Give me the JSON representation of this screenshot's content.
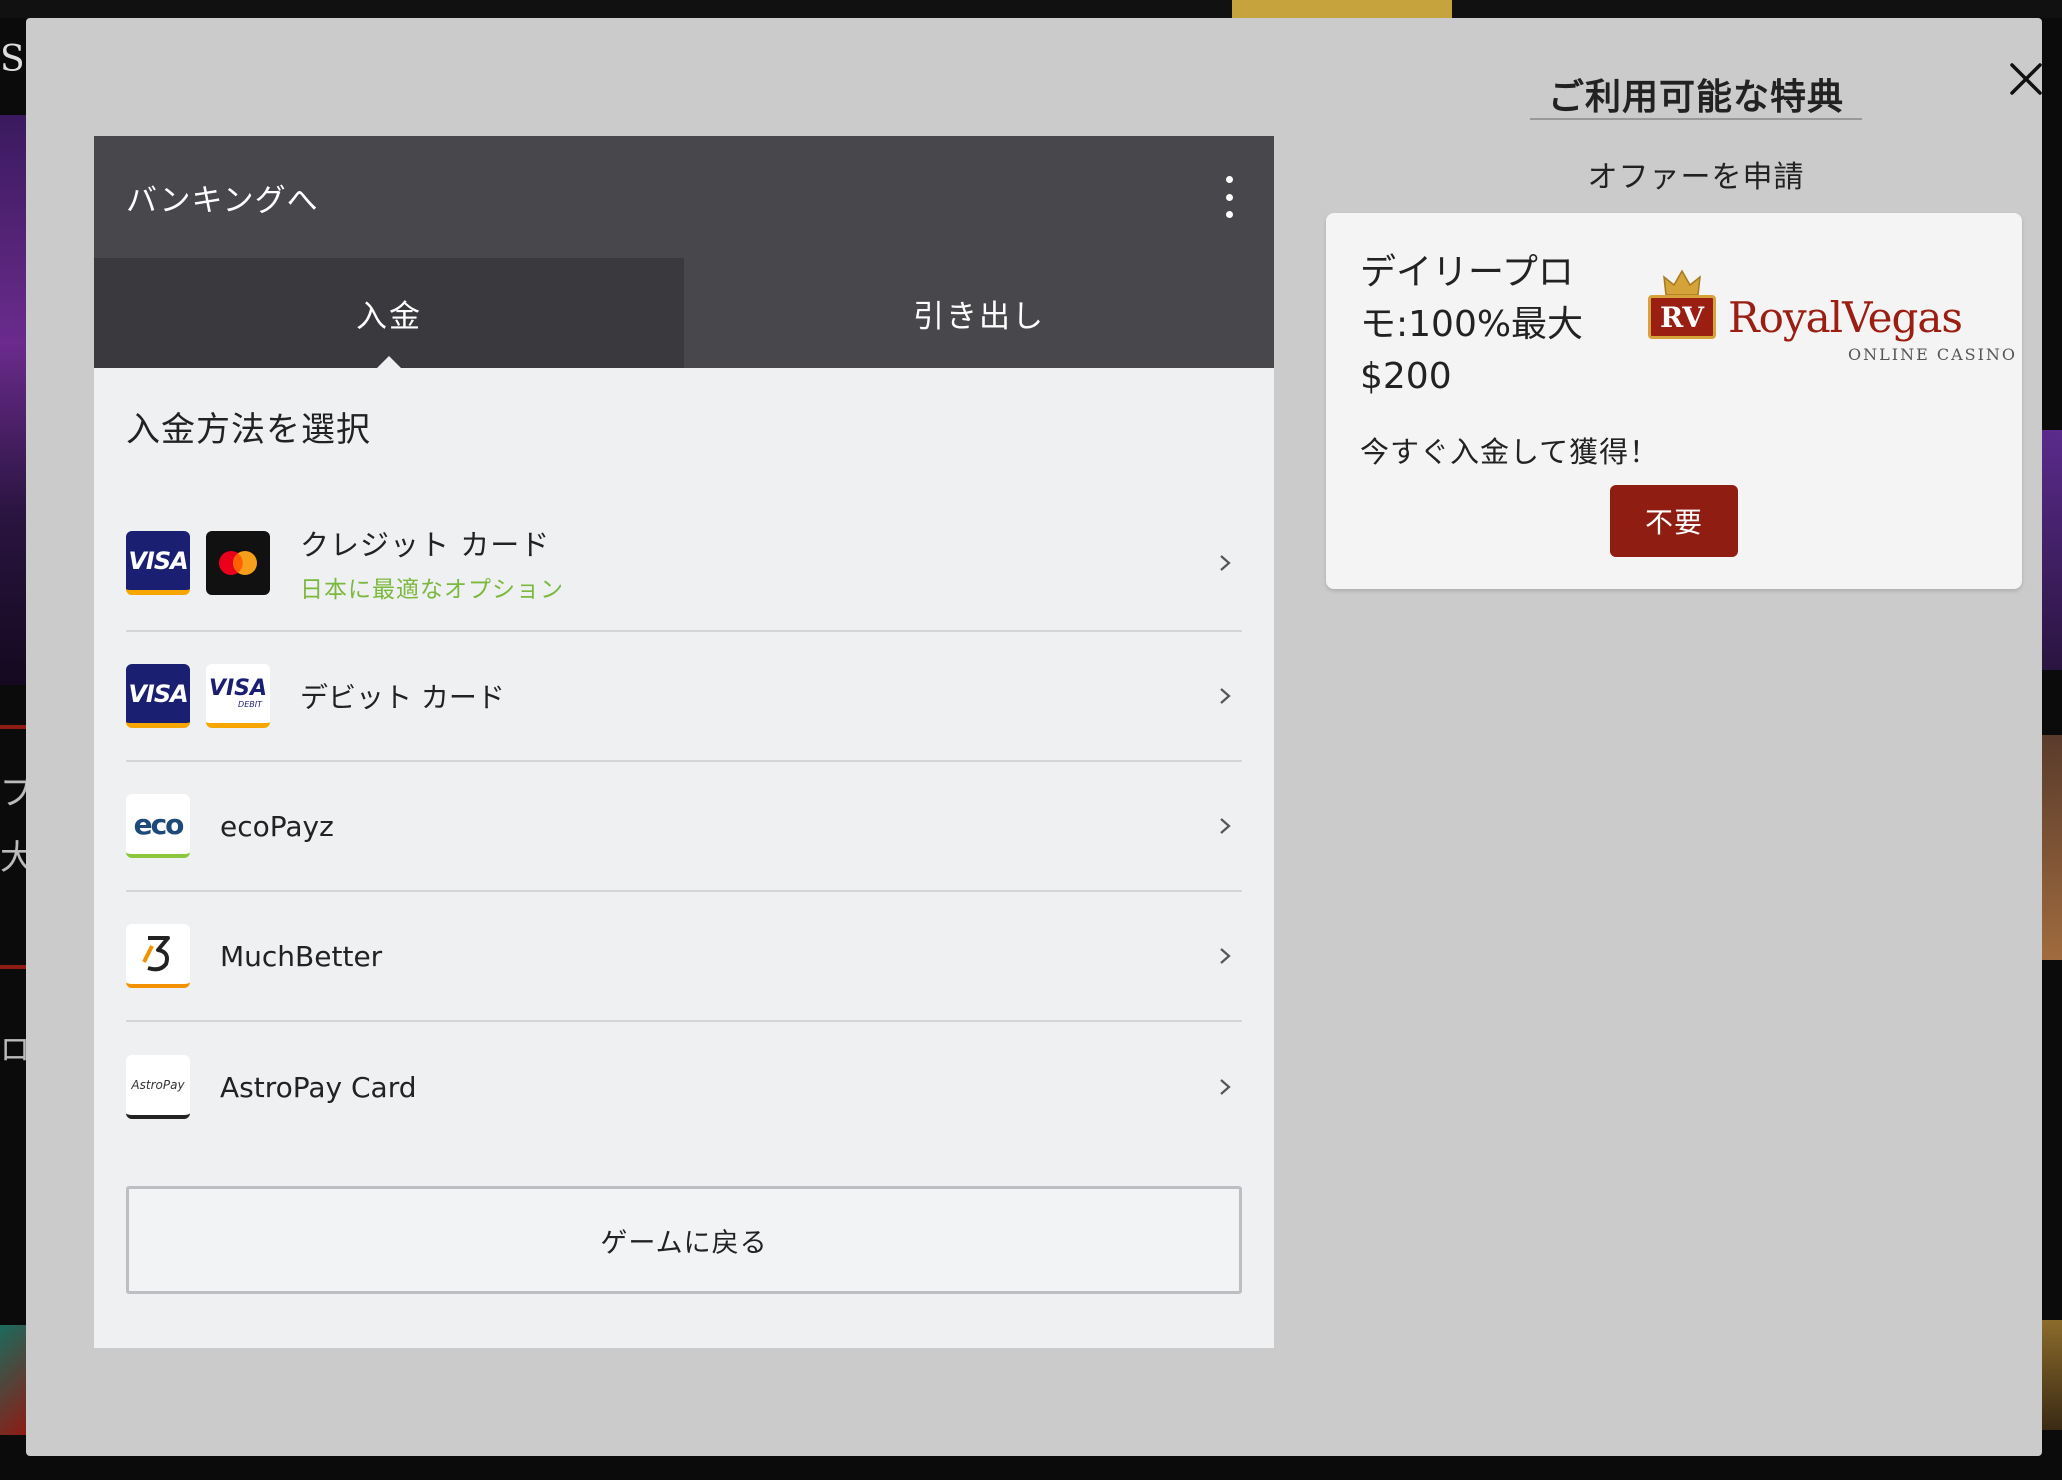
{
  "bg": {
    "logo_letter": "S",
    "left_text_1": "プロ",
    "left_text_2": "大",
    "left_text_3": "ロ"
  },
  "offers": {
    "title": "ご利用可能な特典",
    "link": "オファーを申請",
    "card": {
      "name": "デイリープロモ:100%最大$200",
      "description": "今すぐ入金して獲得！",
      "decline_label": "不要",
      "brand": {
        "badge": "RV",
        "wordmark": "RoyalVegas",
        "sub": "ONLINE CASINO"
      }
    }
  },
  "banking": {
    "title": "バンキングへ",
    "tabs": [
      {
        "label": "入金",
        "active": true
      },
      {
        "label": "引き出し",
        "active": false
      }
    ],
    "section_title": "入金方法を選択",
    "methods": [
      {
        "name": "クレジット カード",
        "sub": "日本に最適なオプション",
        "icons": [
          "visa-icon",
          "mastercard-icon"
        ]
      },
      {
        "name": "デビット カード",
        "icons": [
          "visa-icon",
          "visa-debit-icon"
        ]
      },
      {
        "name": "ecoPayz",
        "icons": [
          "ecopayz-icon"
        ]
      },
      {
        "name": "MuchBetter",
        "icons": [
          "muchbetter-icon"
        ]
      },
      {
        "name": "AstroPay Card",
        "icons": [
          "astropay-icon"
        ]
      }
    ],
    "back_label": "ゲームに戻る"
  },
  "logos": {
    "visa": "VISA",
    "visa_debit_word": "DEBIT",
    "eco": "eco",
    "astropay": "AstroPay"
  },
  "colors": {
    "header_bg": "#48474c",
    "tab_active_bg": "#3a393d",
    "accent_green": "#7cb83e",
    "decline_red": "#8f1d12",
    "modal_bg": "#cbcbcb"
  }
}
